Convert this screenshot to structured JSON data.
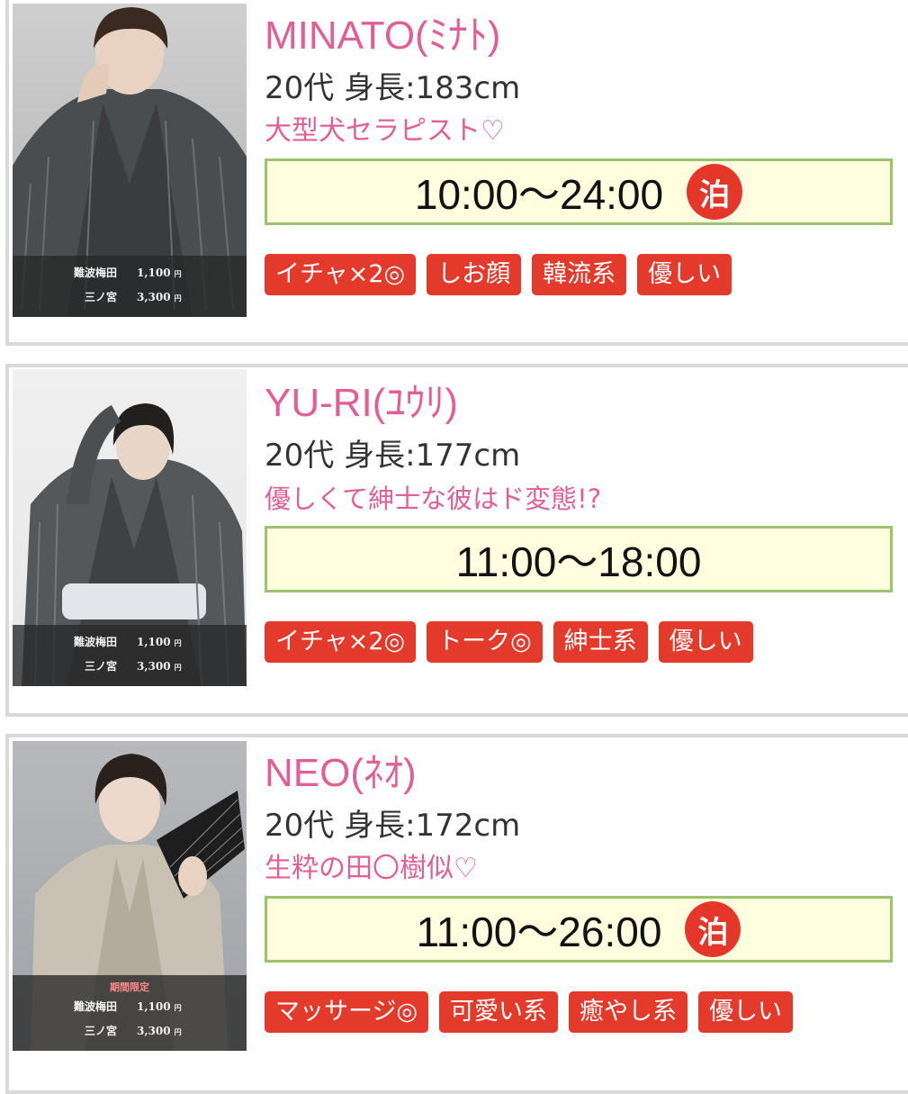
{
  "colors": {
    "name": "#e05f97",
    "catch": "#e05f97",
    "hours_bg": "#ffffe0",
    "hours_border": "#9bc36b",
    "tag": "#e33a2c",
    "stay_badge": "#e5362a"
  },
  "therapists": [
    {
      "name": "MINATO(ﾐﾅﾄ)",
      "specs": "20代 身長:183cm",
      "catch": "大型犬セラピスト♡",
      "hours": "10:00〜24:00",
      "stay_badge": "泊",
      "photo_icon": "therapist-photo",
      "prices": [
        {
          "location": "難波梅田",
          "amount": "1,100",
          "unit": "円"
        },
        {
          "location": "三ノ宮",
          "amount": "3,300",
          "unit": "円"
        }
      ],
      "tags": [
        "イチャ×2◎",
        "しお顔",
        "韓流系",
        "優しい"
      ]
    },
    {
      "name": "YU-RI(ﾕｳﾘ)",
      "specs": "20代 身長:177cm",
      "catch": "優しくて紳士な彼はド変態!?",
      "hours": "11:00〜18:00",
      "photo_icon": "therapist-photo",
      "prices": [
        {
          "location": "難波梅田",
          "amount": "1,100",
          "unit": "円"
        },
        {
          "location": "三ノ宮",
          "amount": "3,300",
          "unit": "円"
        }
      ],
      "tags": [
        "イチャ×2◎",
        "トーク◎",
        "紳士系",
        "優しい"
      ]
    },
    {
      "name": "NEO(ﾈｵ)",
      "specs": "20代 身長:172cm",
      "catch": "生粋の田〇樹似♡",
      "hours": "11:00〜26:00",
      "stay_badge": "泊",
      "photo_icon": "therapist-photo",
      "limited": "期間限定",
      "prices": [
        {
          "location": "難波梅田",
          "amount": "1,100",
          "unit": "円"
        },
        {
          "location": "三ノ宮",
          "amount": "3,300",
          "unit": "円"
        }
      ],
      "tags": [
        "マッサージ◎",
        "可愛い系",
        "癒やし系",
        "優しい"
      ]
    }
  ]
}
